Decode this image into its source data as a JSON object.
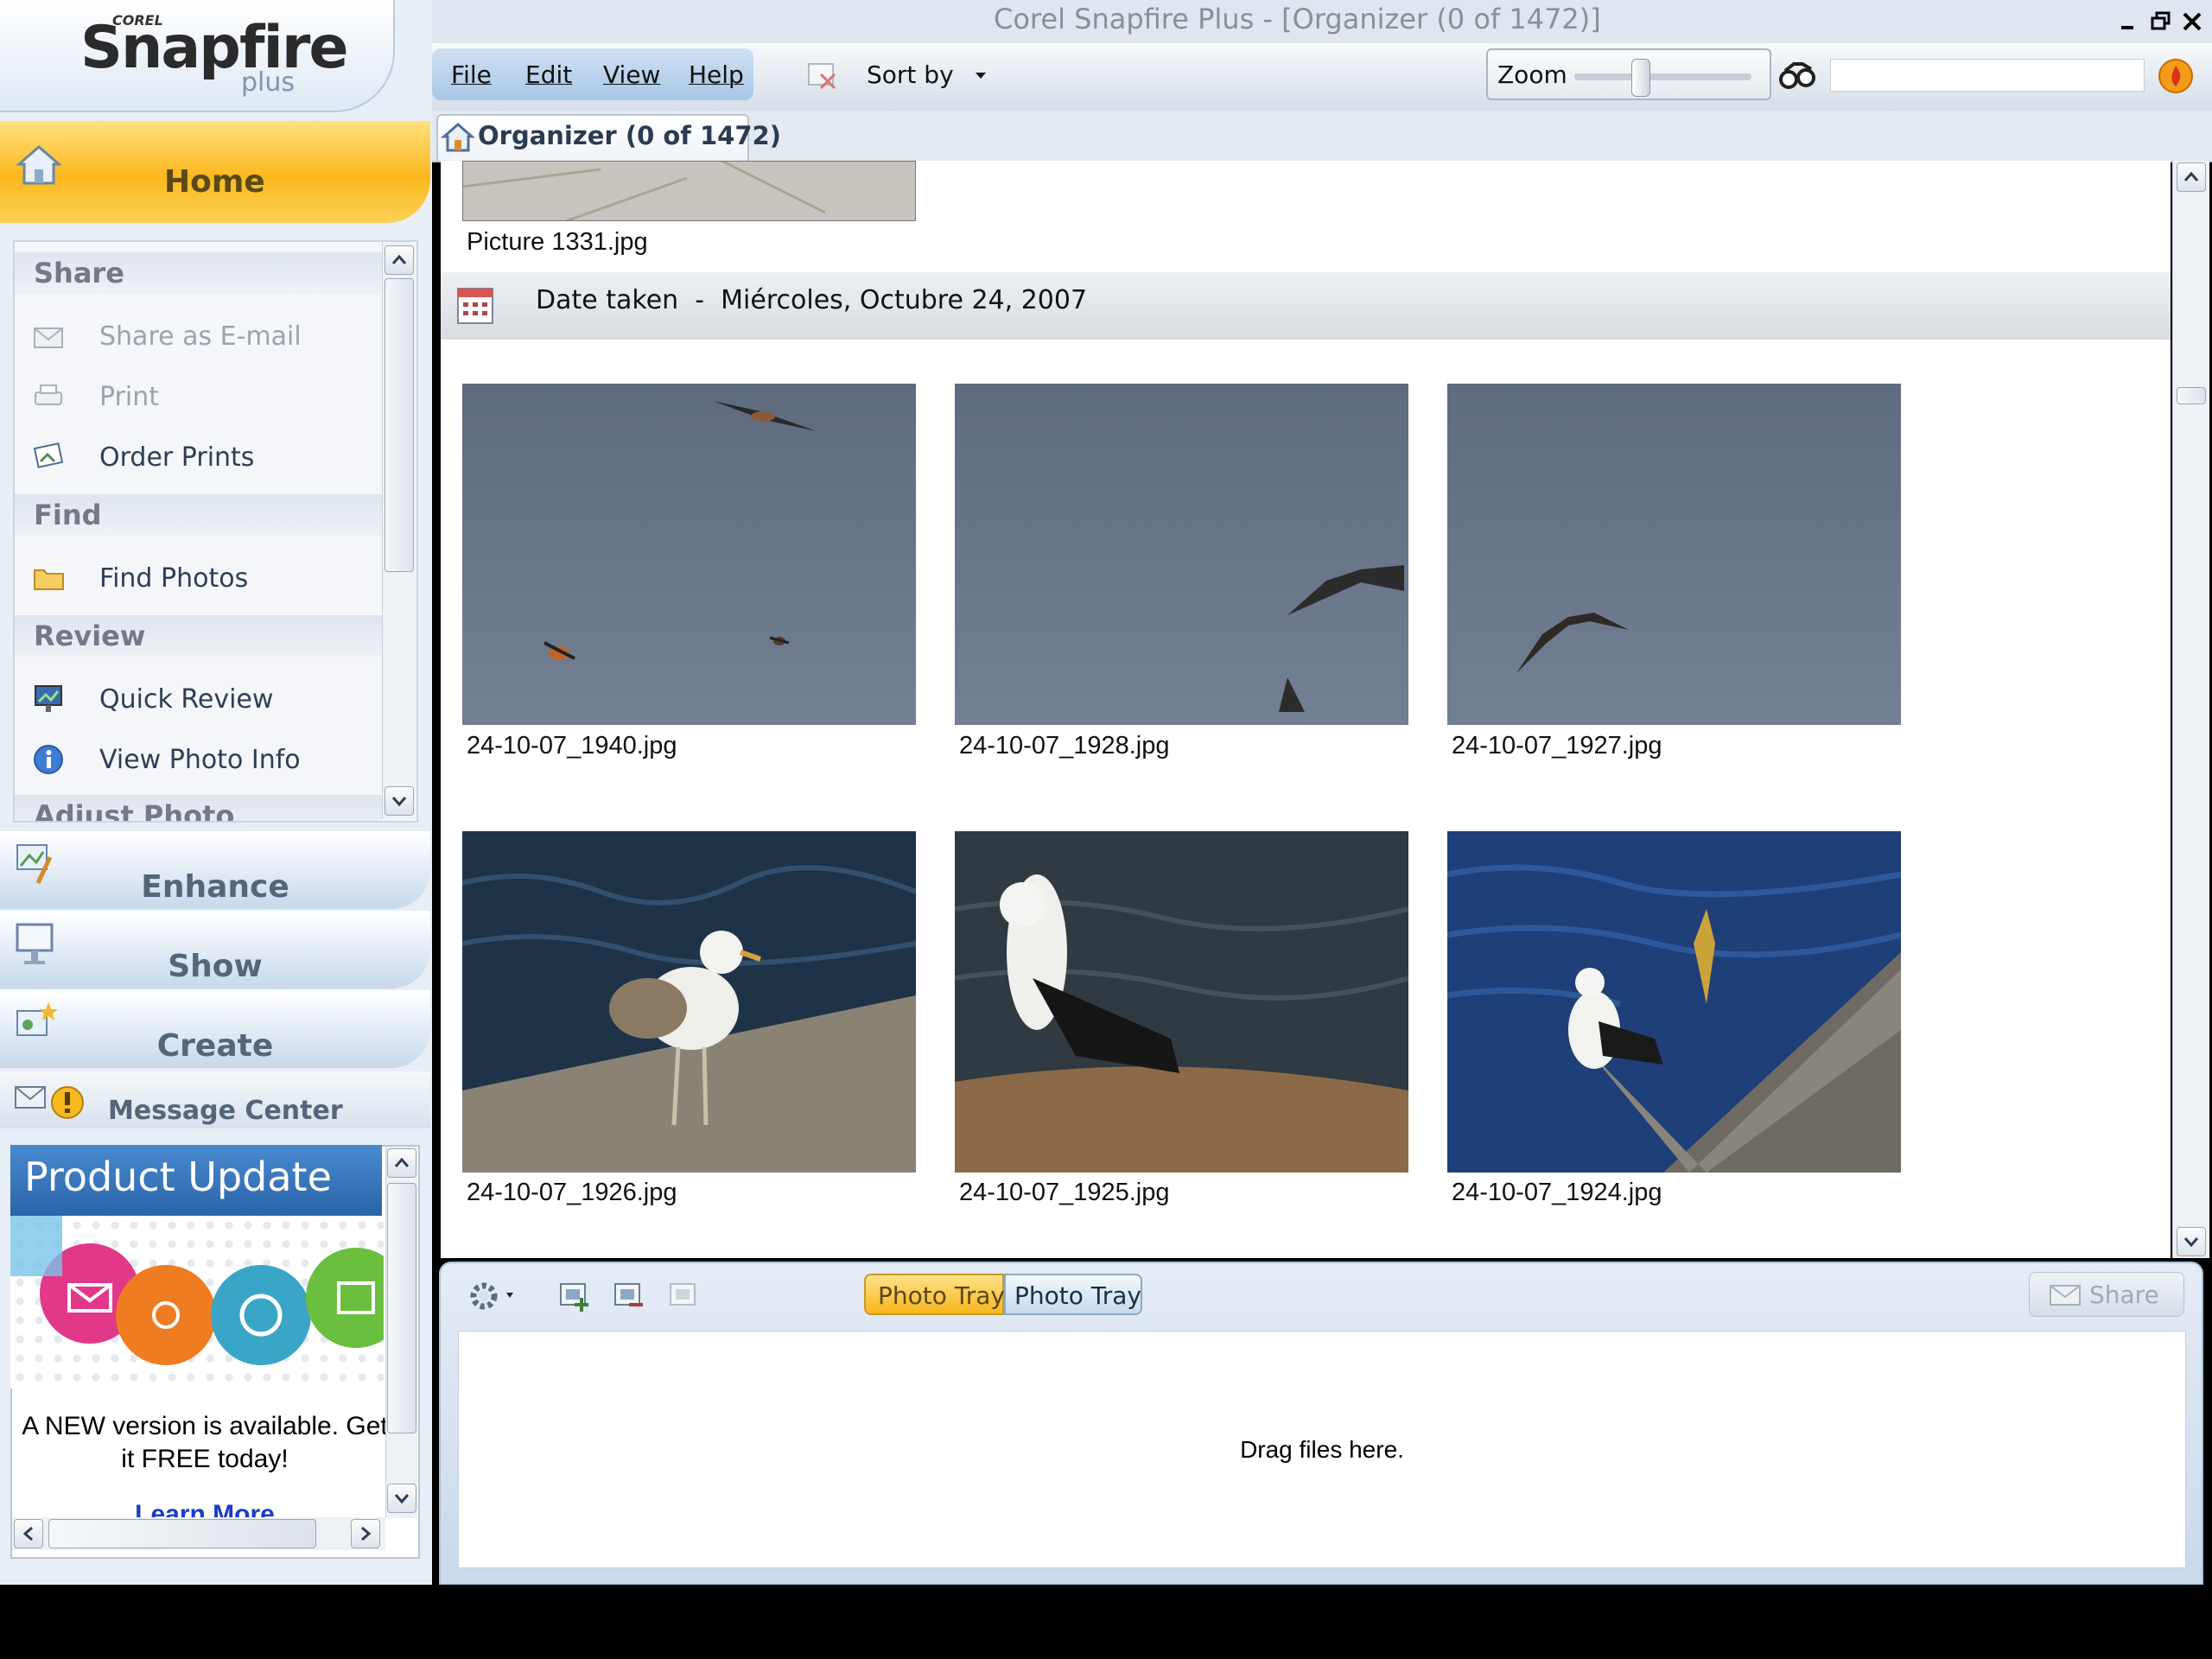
{
  "window": {
    "title": "Corel Snapfire Plus - [Organizer (0 of 1472)]"
  },
  "logo": {
    "corel": "COREL",
    "snapfire": "Snapfire",
    "plus": "plus"
  },
  "nav": {
    "home": "Home",
    "enhance": "Enhance",
    "show": "Show",
    "create": "Create",
    "message_center": "Message Center"
  },
  "tasks": {
    "share_header": "Share",
    "share_email": "Share as E-mail",
    "print": "Print",
    "order_prints": "Order Prints",
    "find_header": "Find",
    "find_photos": "Find Photos",
    "review_header": "Review",
    "quick_review": "Quick Review",
    "view_photo_info": "View Photo Info",
    "adjust_header": "Adjust Photo"
  },
  "product_update": {
    "title": "Product Update",
    "text": "A NEW version is available. Get it FREE today!",
    "link": "Learn More"
  },
  "menu": {
    "file": "File",
    "edit": "Edit",
    "view": "View",
    "help": "Help"
  },
  "toolbar": {
    "sort_by": "Sort by",
    "zoom": "Zoom",
    "search_value": ""
  },
  "organizer_tab": {
    "label": "Organizer (0 of 1472)"
  },
  "grid": {
    "top_file": "Picture 1331.jpg",
    "date_prefix": "Date taken",
    "date_value": "Miércoles, Octubre 24, 2007",
    "photos": [
      "24-10-07_1940.jpg",
      "24-10-07_1928.jpg",
      "24-10-07_1927.jpg",
      "24-10-07_1926.jpg",
      "24-10-07_1925.jpg",
      "24-10-07_1924.jpg"
    ]
  },
  "tray": {
    "tab1": "Photo Tray",
    "tab2": "Photo Tray",
    "share": "Share",
    "drop_hint": "Drag files here."
  },
  "colors": {
    "home_accent": "#fbb81e",
    "nav_blue": "#c7d8ea",
    "product_update_blue": "#2a64a8",
    "link_blue": "#1a3cc8"
  }
}
